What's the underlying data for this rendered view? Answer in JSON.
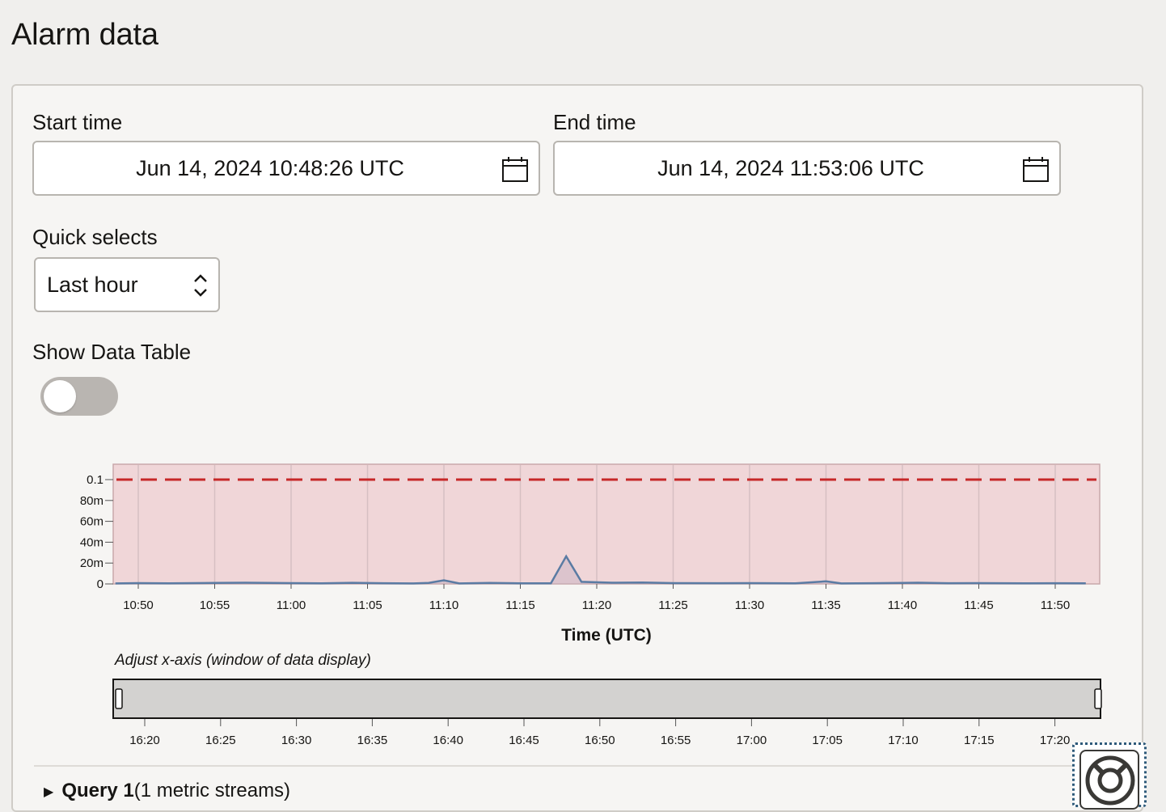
{
  "page": {
    "title": "Alarm data"
  },
  "start_time": {
    "label": "Start time",
    "value": "Jun 14, 2024 10:48:26 UTC",
    "icon": "calendar-icon"
  },
  "end_time": {
    "label": "End time",
    "value": "Jun 14, 2024 11:53:06 UTC",
    "icon": "calendar-icon"
  },
  "quick_selects": {
    "label": "Quick selects",
    "value": "Last hour",
    "icon": "chevron-up-down-icon"
  },
  "data_table": {
    "label": "Show Data Table",
    "enabled": false
  },
  "chart_data": {
    "type": "line",
    "title": "",
    "xlabel": "Time (UTC)",
    "ylabel": "",
    "x_ticks": [
      "10:50",
      "10:55",
      "11:00",
      "11:05",
      "11:10",
      "11:15",
      "11:20",
      "11:25",
      "11:30",
      "11:35",
      "11:40",
      "11:45",
      "11:50"
    ],
    "y_ticks": [
      "0",
      "20m",
      "40m",
      "60m",
      "80m",
      "0.1"
    ],
    "ylim": [
      0,
      0.1
    ],
    "threshold": {
      "value": 0.1,
      "color": "#c62828",
      "style": "dashed"
    },
    "alarm_zone_color": "#f0d6d8",
    "series": [
      {
        "color": "#5a7ba3",
        "points": [
          [
            "10:48:30",
            0.0005
          ],
          [
            "10:50",
            0.0008
          ],
          [
            "10:52",
            0.0006
          ],
          [
            "10:55",
            0.0009
          ],
          [
            "10:57",
            0.0012
          ],
          [
            "11:00",
            0.0008
          ],
          [
            "11:02",
            0.0006
          ],
          [
            "11:04",
            0.0011
          ],
          [
            "11:06",
            0.0007
          ],
          [
            "11:08",
            0.0005
          ],
          [
            "11:09",
            0.001
          ],
          [
            "11:10",
            0.0035
          ],
          [
            "11:11",
            0.0005
          ],
          [
            "11:13",
            0.0009
          ],
          [
            "11:15",
            0.0006
          ],
          [
            "11:17",
            0.0006
          ],
          [
            "11:18",
            0.0265
          ],
          [
            "11:19",
            0.002
          ],
          [
            "11:21",
            0.0012
          ],
          [
            "11:23",
            0.0014
          ],
          [
            "11:25",
            0.0008
          ],
          [
            "11:28",
            0.0007
          ],
          [
            "11:30",
            0.0008
          ],
          [
            "11:33",
            0.0006
          ],
          [
            "11:35",
            0.0025
          ],
          [
            "11:36",
            0.0005
          ],
          [
            "11:38",
            0.0007
          ],
          [
            "11:40",
            0.0009
          ],
          [
            "11:41",
            0.0012
          ],
          [
            "11:43",
            0.0007
          ],
          [
            "11:45",
            0.0008
          ],
          [
            "11:48",
            0.0006
          ],
          [
            "11:50",
            0.0007
          ],
          [
            "11:52",
            0.0006
          ]
        ]
      }
    ],
    "grid": true
  },
  "range_selector": {
    "caption": "Adjust x-axis (window of data display)",
    "ticks": [
      "16:20",
      "16:25",
      "16:30",
      "16:35",
      "16:40",
      "16:45",
      "16:50",
      "16:55",
      "17:00",
      "17:05",
      "17:10",
      "17:15",
      "17:20"
    ]
  },
  "query": {
    "name": "Query 1",
    "detail": "(1 metric streams)"
  },
  "help": {
    "icon": "lifebuoy-icon"
  }
}
